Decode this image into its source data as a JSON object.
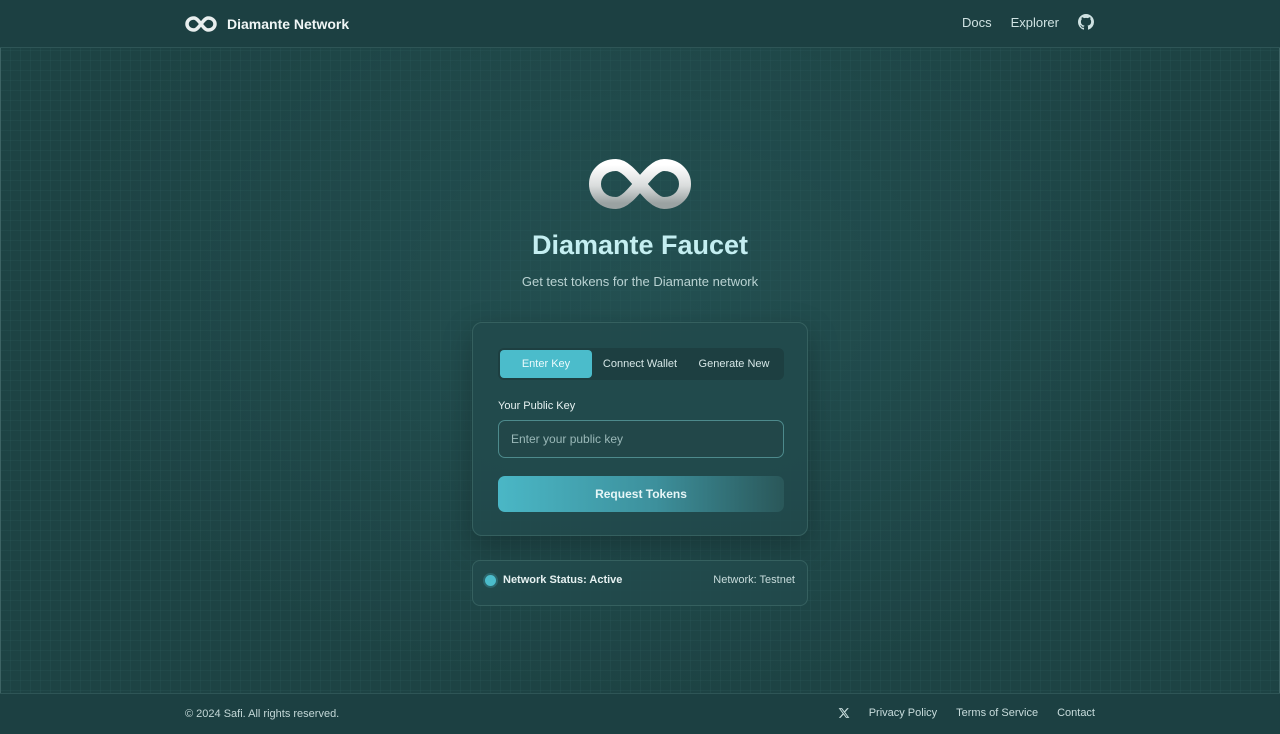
{
  "header": {
    "brand_name": "Diamante Network",
    "brand_icon": "infinity-logo-icon",
    "nav": {
      "docs": "Docs",
      "explorer": "Explorer",
      "github_icon": "github-icon"
    }
  },
  "hero": {
    "logo_icon": "infinity-logo-icon",
    "title": "Diamante Faucet",
    "subtitle": "Get test tokens for the Diamante network"
  },
  "form": {
    "tabs": [
      {
        "label": "Enter Key",
        "active": true
      },
      {
        "label": "Connect Wallet",
        "active": false
      },
      {
        "label": "Generate New",
        "active": false
      }
    ],
    "key_label": "Your Public Key",
    "key_value": "",
    "key_placeholder": "Enter your public key",
    "submit_label": "Request Tokens"
  },
  "status": {
    "text": "Network Status: Active",
    "network": "Network: Testnet",
    "dot_color": "#4bbccb"
  },
  "footer": {
    "copyright": "© 2024 Safi. All rights reserved.",
    "x_icon": "x-twitter-icon",
    "links": {
      "privacy": "Privacy Policy",
      "terms": "Terms of Service",
      "contact": "Contact"
    }
  },
  "colors": {
    "accent": "#4bbccb",
    "background": "#1d4344",
    "title": "#c4eef1"
  }
}
